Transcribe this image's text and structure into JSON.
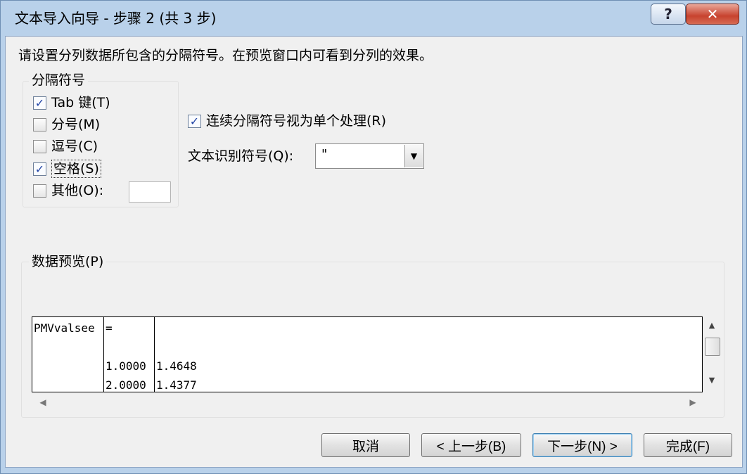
{
  "window": {
    "title": "文本导入向导 - 步骤 2 (共 3 步)",
    "help_glyph": "?",
    "close_glyph": "✕"
  },
  "instruction": "请设置分列数据所包含的分隔符号。在预览窗口内可看到分列的效果。",
  "delimiters": {
    "legend": "分隔符号",
    "items": [
      {
        "label": "Tab 键(T)",
        "checked": true,
        "mark": "✓"
      },
      {
        "label": "分号(M)",
        "checked": false,
        "mark": ""
      },
      {
        "label": "逗号(C)",
        "checked": false,
        "mark": ""
      },
      {
        "label": "空格(S)",
        "checked": true,
        "mark": "✓"
      },
      {
        "label": "其他(O):",
        "checked": false,
        "mark": ""
      }
    ],
    "other_value": ""
  },
  "consecutive": {
    "label": "连续分隔符号视为单个处理(R)",
    "checked": true,
    "mark": "✓"
  },
  "text_qualifier": {
    "label": "文本识别符号(Q):",
    "value": "\""
  },
  "preview": {
    "legend": "数据预览(P)",
    "rows": [
      [
        "PMVvalsee",
        "=",
        ""
      ],
      [
        "",
        "",
        ""
      ],
      [
        "",
        "1.0000",
        "1.4648"
      ],
      [
        "",
        "2.0000",
        "1.4377"
      ]
    ]
  },
  "buttons": {
    "cancel": "取消",
    "back": "< 上一步(B)",
    "next": "下一步(N) >",
    "finish": "完成(F)"
  },
  "colors": {
    "title_bg": "#b9d1ea",
    "dialog_bg": "#f0f0f0",
    "close_button": "#c7432f",
    "check_mark": "#2446a6"
  }
}
